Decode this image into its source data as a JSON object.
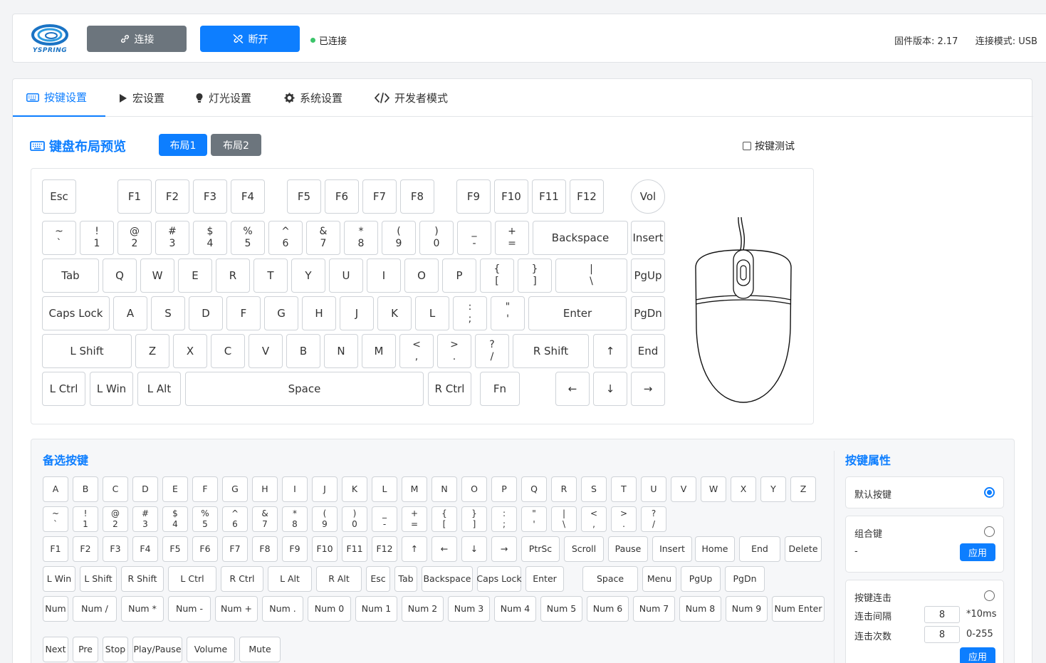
{
  "header": {
    "logo_text": "YSPRING",
    "connect_label": "连接",
    "disconnect_label": "断开",
    "status_text": "已连接",
    "status_color": "#3cc46a",
    "firmware_label": "固件版本: 2.17",
    "connection_mode_label": "连接模式: USB"
  },
  "tabs": [
    {
      "label": "按键设置",
      "icon": "keyboard-icon",
      "active": true
    },
    {
      "label": "宏设置",
      "icon": "play-icon"
    },
    {
      "label": "灯光设置",
      "icon": "bulb-icon"
    },
    {
      "label": "系统设置",
      "icon": "gear-icon"
    },
    {
      "label": "开发者模式",
      "icon": "code-icon"
    }
  ],
  "keyboard": {
    "title": "键盘布局预览",
    "layout1_label": "布局1",
    "layout2_label": "布局2",
    "key_test_label": "按键测试",
    "rows": [
      [
        [
          "Esc"
        ],
        [
          "F1"
        ],
        [
          "F2"
        ],
        [
          "F3"
        ],
        [
          "F4"
        ],
        [
          "F5"
        ],
        [
          "F6"
        ],
        [
          "F7"
        ],
        [
          "F8"
        ],
        [
          "F9"
        ],
        [
          "F10"
        ],
        [
          "F11"
        ],
        [
          "F12"
        ],
        [
          "Vol"
        ]
      ],
      [
        [
          "~",
          "`"
        ],
        [
          "!",
          "1"
        ],
        [
          "@",
          "2"
        ],
        [
          "#",
          "3"
        ],
        [
          "$",
          "4"
        ],
        [
          "%",
          "5"
        ],
        [
          "^",
          "6"
        ],
        [
          "&",
          "7"
        ],
        [
          "*",
          "8"
        ],
        [
          "(",
          "9"
        ],
        [
          ")",
          "0"
        ],
        [
          "_",
          "-"
        ],
        [
          "+",
          "="
        ],
        [
          "Backspace"
        ],
        [
          "Insert"
        ]
      ],
      [
        [
          "Tab"
        ],
        [
          "Q"
        ],
        [
          "W"
        ],
        [
          "E"
        ],
        [
          "R"
        ],
        [
          "T"
        ],
        [
          "Y"
        ],
        [
          "U"
        ],
        [
          "I"
        ],
        [
          "O"
        ],
        [
          "P"
        ],
        [
          "{",
          "["
        ],
        [
          "}",
          "]"
        ],
        [
          "|",
          "\\"
        ],
        [
          "PgUp"
        ]
      ],
      [
        [
          "Caps Lock"
        ],
        [
          "A"
        ],
        [
          "S"
        ],
        [
          "D"
        ],
        [
          "F"
        ],
        [
          "G"
        ],
        [
          "H"
        ],
        [
          "J"
        ],
        [
          "K"
        ],
        [
          "L"
        ],
        [
          ":",
          ";"
        ],
        [
          "\"",
          "'"
        ],
        [
          "Enter"
        ],
        [
          "PgDn"
        ]
      ],
      [
        [
          "L Shift"
        ],
        [
          "Z"
        ],
        [
          "X"
        ],
        [
          "C"
        ],
        [
          "V"
        ],
        [
          "B"
        ],
        [
          "N"
        ],
        [
          "M"
        ],
        [
          "<",
          ","
        ],
        [
          ">",
          "."
        ],
        [
          "?",
          "/"
        ],
        [
          "R Shift"
        ],
        [
          "↑"
        ],
        [
          "End"
        ]
      ],
      [
        [
          "L Ctrl"
        ],
        [
          "L Win"
        ],
        [
          "L Alt"
        ],
        [
          "Space"
        ],
        [
          "R Ctrl"
        ],
        [
          "Fn"
        ],
        [
          "←"
        ],
        [
          "↓"
        ],
        [
          "→"
        ]
      ]
    ]
  },
  "library": {
    "title": "备选按键",
    "rows": [
      [
        [
          "A"
        ],
        [
          "B"
        ],
        [
          "C"
        ],
        [
          "D"
        ],
        [
          "E"
        ],
        [
          "F"
        ],
        [
          "G"
        ],
        [
          "H"
        ],
        [
          "I"
        ],
        [
          "J"
        ],
        [
          "K"
        ],
        [
          "L"
        ],
        [
          "M"
        ],
        [
          "N"
        ],
        [
          "O"
        ],
        [
          "P"
        ],
        [
          "Q"
        ],
        [
          "R"
        ],
        [
          "S"
        ],
        [
          "T"
        ],
        [
          "U"
        ],
        [
          "V"
        ],
        [
          "W"
        ],
        [
          "X"
        ],
        [
          "Y"
        ],
        [
          "Z"
        ]
      ],
      [
        [
          "~",
          "`"
        ],
        [
          "!",
          "1"
        ],
        [
          "@",
          "2"
        ],
        [
          "#",
          "3"
        ],
        [
          "$",
          "4"
        ],
        [
          "%",
          "5"
        ],
        [
          "^",
          "6"
        ],
        [
          "&",
          "7"
        ],
        [
          "*",
          "8"
        ],
        [
          "(",
          "9"
        ],
        [
          ")",
          "0"
        ],
        [
          "_",
          "-"
        ],
        [
          "+",
          "="
        ],
        [
          "{",
          "["
        ],
        [
          "}",
          "]"
        ],
        [
          ":",
          ";"
        ],
        [
          "\"",
          "'"
        ],
        [
          "|",
          "\\"
        ],
        [
          "<",
          ","
        ],
        [
          ">",
          "."
        ],
        [
          "?",
          "/"
        ]
      ],
      [
        [
          "F1"
        ],
        [
          "F2"
        ],
        [
          "F3"
        ],
        [
          "F4"
        ],
        [
          "F5"
        ],
        [
          "F6"
        ],
        [
          "F7"
        ],
        [
          "F8"
        ],
        [
          "F9"
        ],
        [
          "F10"
        ],
        [
          "F11"
        ],
        [
          "F12"
        ],
        [
          "↑"
        ],
        [
          "←"
        ],
        [
          "↓"
        ],
        [
          "→"
        ],
        [
          "PtrSc"
        ],
        [
          "Scroll"
        ],
        [
          "Pause"
        ],
        [
          "Insert"
        ],
        [
          "Home"
        ],
        [
          "End"
        ],
        [
          "Delete"
        ]
      ],
      [
        [
          "L Win"
        ],
        [
          "L Shift"
        ],
        [
          "R Shift"
        ],
        [
          "L Ctrl"
        ],
        [
          "R Ctrl"
        ],
        [
          "L Alt"
        ],
        [
          "R Alt"
        ],
        [
          "Esc"
        ],
        [
          "Tab"
        ],
        [
          "Backspace"
        ],
        [
          "Caps Lock"
        ],
        [
          "Enter"
        ],
        [
          "Space"
        ],
        [
          "Menu"
        ],
        [
          "PgUp"
        ],
        [
          "PgDn"
        ]
      ],
      [
        [
          "Num"
        ],
        [
          "Num /"
        ],
        [
          "Num *"
        ],
        [
          "Num -"
        ],
        [
          "Num +"
        ],
        [
          "Num ."
        ],
        [
          "Num 0"
        ],
        [
          "Num 1"
        ],
        [
          "Num 2"
        ],
        [
          "Num 3"
        ],
        [
          "Num 4"
        ],
        [
          "Num 5"
        ],
        [
          "Num 6"
        ],
        [
          "Num 7"
        ],
        [
          "Num 8"
        ],
        [
          "Num 9"
        ],
        [
          "Num Enter"
        ]
      ],
      [
        [
          "Next"
        ],
        [
          "Pre"
        ],
        [
          "Stop"
        ],
        [
          "Play/Pause"
        ],
        [
          "Volume"
        ],
        [
          "Mute"
        ]
      ]
    ]
  },
  "properties": {
    "title": "按键属性",
    "default_key_label": "默认按键",
    "combo_key_label": "组合键",
    "combo_value": "-",
    "apply_label": "应用",
    "repeat_label": "按键连击",
    "interval_label": "连击间隔",
    "interval_value": "8",
    "interval_unit": "*10ms",
    "count_label": "连击次数",
    "count_value": "8",
    "count_range": "0-255"
  }
}
